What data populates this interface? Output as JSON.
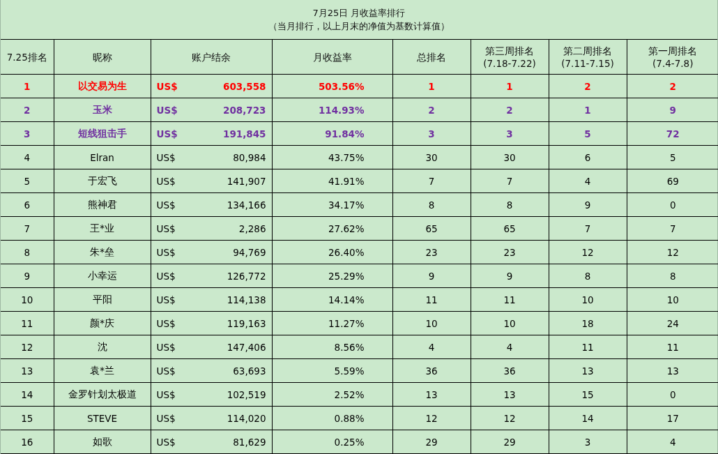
{
  "title": "7月25日 月收益率排行",
  "subtitle": "（当月排行，以上月末的净值为基数计算值）",
  "columns": [
    {
      "label": "7.25排名"
    },
    {
      "label": "昵称"
    },
    {
      "label": "账户结余"
    },
    {
      "label": "月收益率"
    },
    {
      "label": "总排名"
    },
    {
      "label": "第三周排名",
      "sub": "(7.18-7.22)"
    },
    {
      "label": "第二周排名",
      "sub": "(7.11-7.15)"
    },
    {
      "label": "第一周排名",
      "sub": "(7.4-7.8)"
    }
  ],
  "rows": [
    {
      "rank": "1",
      "name": "以交易为生",
      "currency": "US$",
      "balance": "603,558",
      "return": "503.56%",
      "total": "1",
      "week3": "1",
      "week2": "2",
      "week1": "2",
      "color": "#ff0000",
      "highlighted": true
    },
    {
      "rank": "2",
      "name": "玉米",
      "currency": "US$",
      "balance": "208,723",
      "return": "114.93%",
      "total": "2",
      "week3": "2",
      "week2": "1",
      "week1": "9",
      "color": "#7030a0",
      "highlighted": true
    },
    {
      "rank": "3",
      "name": "短线狙击手",
      "currency": "US$",
      "balance": "191,845",
      "return": "91.84%",
      "total": "3",
      "week3": "3",
      "week2": "5",
      "week1": "72",
      "color": "#7030a0",
      "highlighted": true
    },
    {
      "rank": "4",
      "name": "Elran",
      "currency": "US$",
      "balance": "80,984",
      "return": "43.75%",
      "total": "30",
      "week3": "30",
      "week2": "6",
      "week1": "5",
      "color": "#000000",
      "highlighted": false
    },
    {
      "rank": "5",
      "name": "于宏飞",
      "currency": "US$",
      "balance": "141,907",
      "return": "41.91%",
      "total": "7",
      "week3": "7",
      "week2": "4",
      "week1": "69",
      "color": "#000000",
      "highlighted": false
    },
    {
      "rank": "6",
      "name": "熊神君",
      "currency": "US$",
      "balance": "134,166",
      "return": "34.17%",
      "total": "8",
      "week3": "8",
      "week2": "9",
      "week1": "0",
      "color": "#000000",
      "highlighted": false
    },
    {
      "rank": "7",
      "name": "王*业",
      "currency": "US$",
      "balance": "2,286",
      "return": "27.62%",
      "total": "65",
      "week3": "65",
      "week2": "7",
      "week1": "7",
      "color": "#000000",
      "highlighted": false
    },
    {
      "rank": "8",
      "name": "朱*垒",
      "currency": "US$",
      "balance": "94,769",
      "return": "26.40%",
      "total": "23",
      "week3": "23",
      "week2": "12",
      "week1": "12",
      "color": "#000000",
      "highlighted": false
    },
    {
      "rank": "9",
      "name": "小幸运",
      "currency": "US$",
      "balance": "126,772",
      "return": "25.29%",
      "total": "9",
      "week3": "9",
      "week2": "8",
      "week1": "8",
      "color": "#000000",
      "highlighted": false
    },
    {
      "rank": "10",
      "name": "平阳",
      "currency": "US$",
      "balance": "114,138",
      "return": "14.14%",
      "total": "11",
      "week3": "11",
      "week2": "10",
      "week1": "10",
      "color": "#000000",
      "highlighted": false
    },
    {
      "rank": "11",
      "name": "颜*庆",
      "currency": "US$",
      "balance": "119,163",
      "return": "11.27%",
      "total": "10",
      "week3": "10",
      "week2": "18",
      "week1": "24",
      "color": "#000000",
      "highlighted": false
    },
    {
      "rank": "12",
      "name": "沈",
      "currency": "US$",
      "balance": "147,406",
      "return": "8.56%",
      "total": "4",
      "week3": "4",
      "week2": "11",
      "week1": "11",
      "color": "#000000",
      "highlighted": false
    },
    {
      "rank": "13",
      "name": "袁*兰",
      "currency": "US$",
      "balance": "63,693",
      "return": "5.59%",
      "total": "36",
      "week3": "36",
      "week2": "13",
      "week1": "13",
      "color": "#000000",
      "highlighted": false
    },
    {
      "rank": "14",
      "name": "金罗针划太极道",
      "currency": "US$",
      "balance": "102,519",
      "return": "2.52%",
      "total": "13",
      "week3": "13",
      "week2": "15",
      "week1": "0",
      "color": "#000000",
      "highlighted": false
    },
    {
      "rank": "15",
      "name": "STEVE",
      "currency": "US$",
      "balance": "114,020",
      "return": "0.88%",
      "total": "12",
      "week3": "12",
      "week2": "14",
      "week1": "17",
      "color": "#000000",
      "highlighted": false
    },
    {
      "rank": "16",
      "name": "如歌",
      "currency": "US$",
      "balance": "81,629",
      "return": "0.25%",
      "total": "29",
      "week3": "29",
      "week2": "3",
      "week1": "4",
      "color": "#000000",
      "highlighted": false
    }
  ]
}
